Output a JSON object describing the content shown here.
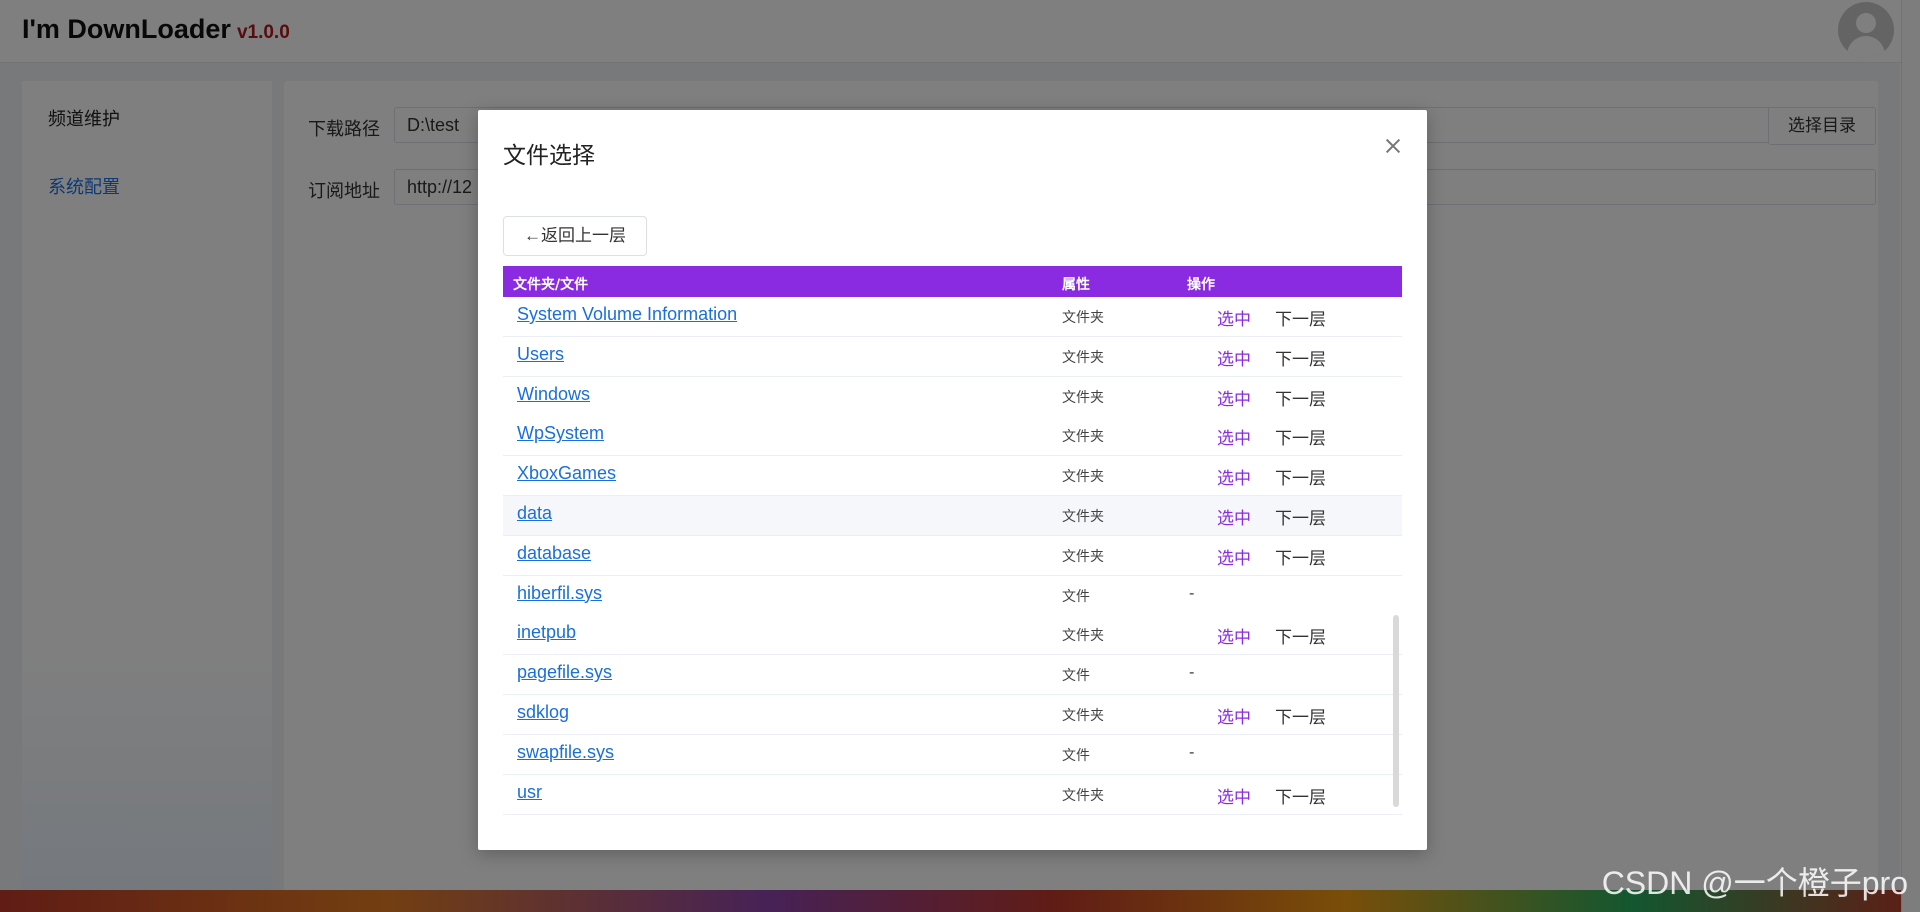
{
  "app": {
    "title": "I'm DownLoader",
    "version": "v1.0.0"
  },
  "sidebar": {
    "items": [
      {
        "label": "频道维护"
      },
      {
        "label": "系统配置"
      }
    ]
  },
  "config": {
    "download_path_label": "下载路径",
    "download_path_value": "D:\\test",
    "browse_button": "选择目录",
    "subscribe_label": "订阅地址",
    "subscribe_value": "http://12"
  },
  "modal": {
    "title": "文件选择",
    "back_button": "←返回上一层",
    "table": {
      "headers": [
        "文件夹/文件",
        "属性",
        "操作"
      ],
      "select_label": "选中",
      "next_label": "下一层",
      "no_action": "-",
      "rows": [
        {
          "name": "System Volume Information",
          "attr": "文件夹",
          "is_dir": true
        },
        {
          "name": "Users",
          "attr": "文件夹",
          "is_dir": true
        },
        {
          "name": "Windows",
          "attr": "文件夹",
          "is_dir": true
        },
        {
          "name": "WpSystem",
          "attr": "文件夹",
          "is_dir": true
        },
        {
          "name": "XboxGames",
          "attr": "文件夹",
          "is_dir": true
        },
        {
          "name": "data",
          "attr": "文件夹",
          "is_dir": true,
          "hover": true
        },
        {
          "name": "database",
          "attr": "文件夹",
          "is_dir": true
        },
        {
          "name": "hiberfil.sys",
          "attr": "文件",
          "is_dir": false
        },
        {
          "name": "inetpub",
          "attr": "文件夹",
          "is_dir": true
        },
        {
          "name": "pagefile.sys",
          "attr": "文件",
          "is_dir": false
        },
        {
          "name": "sdklog",
          "attr": "文件夹",
          "is_dir": true
        },
        {
          "name": "swapfile.sys",
          "attr": "文件",
          "is_dir": false
        },
        {
          "name": "usr",
          "attr": "文件夹",
          "is_dir": true
        }
      ]
    }
  },
  "watermark": "CSDN @一个橙子pro",
  "colors": {
    "table_header": "#8a2be2",
    "select_link": "#8a2be2",
    "version": "#b2191a",
    "link": "#1a6fdb"
  }
}
